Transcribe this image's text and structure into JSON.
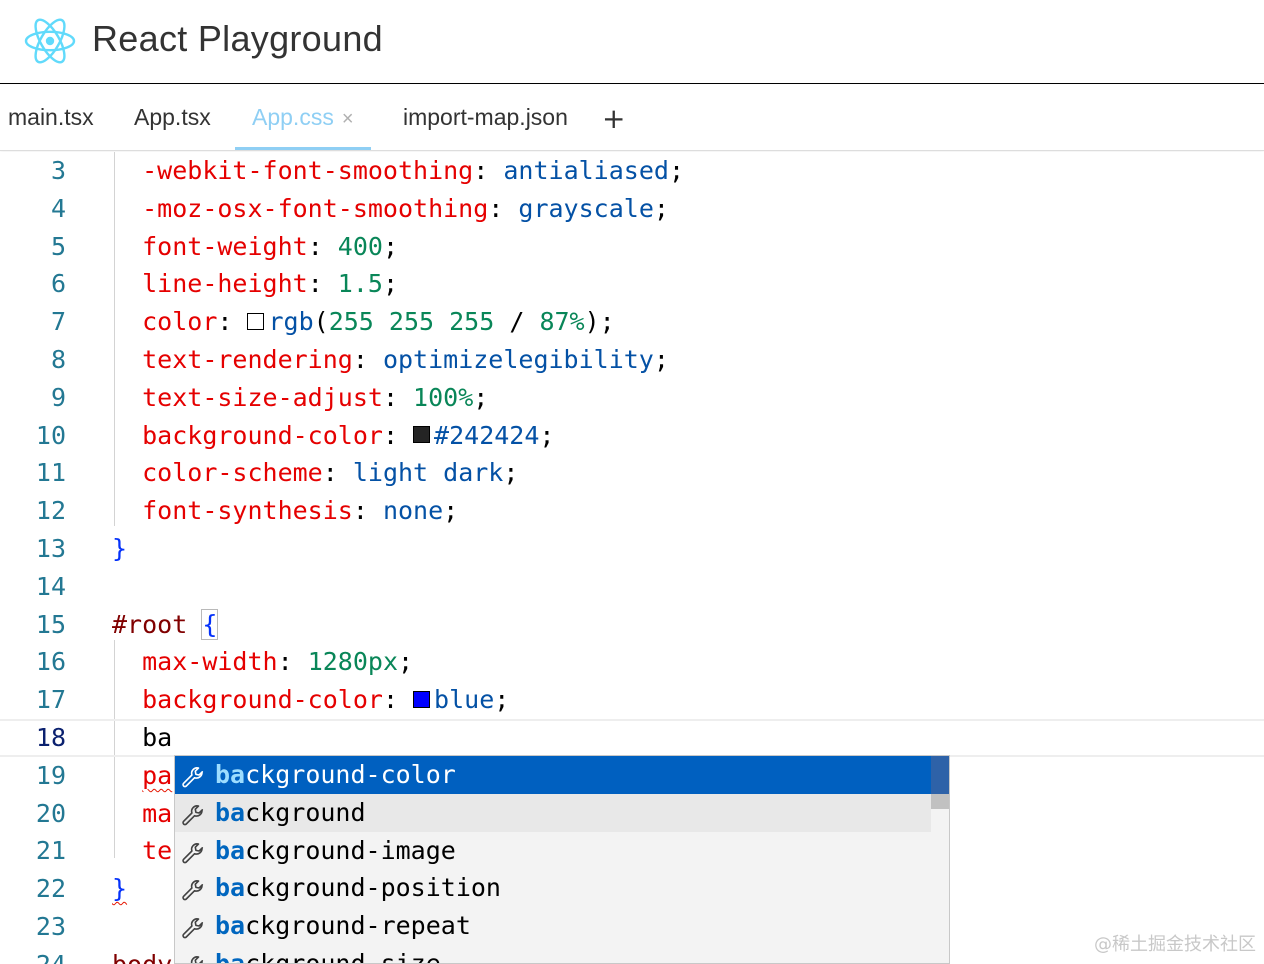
{
  "app": {
    "title": "React Playground",
    "logo_icon": "react-atom-icon",
    "accent_color": "#61dafb"
  },
  "tabs": [
    {
      "label": "main.tsx",
      "active": false
    },
    {
      "label": "App.tsx",
      "active": false
    },
    {
      "label": "App.css",
      "active": true,
      "close": "×"
    },
    {
      "label": "import-map.json",
      "active": false
    }
  ],
  "add_tab_label": "+",
  "editor": {
    "current_line": 18,
    "lines": [
      {
        "n": "3",
        "tokens": [
          [
            "prop",
            "-webkit-font-smoothing"
          ],
          [
            "pun",
            ": "
          ],
          [
            "val",
            "antialiased"
          ],
          [
            "pun",
            ";"
          ]
        ]
      },
      {
        "n": "4",
        "tokens": [
          [
            "prop",
            "-moz-osx-font-smoothing"
          ],
          [
            "pun",
            ": "
          ],
          [
            "val",
            "grayscale"
          ],
          [
            "pun",
            ";"
          ]
        ]
      },
      {
        "n": "5",
        "tokens": [
          [
            "prop",
            "font-weight"
          ],
          [
            "pun",
            ": "
          ],
          [
            "num",
            "400"
          ],
          [
            "pun",
            ";"
          ]
        ]
      },
      {
        "n": "6",
        "tokens": [
          [
            "prop",
            "line-height"
          ],
          [
            "pun",
            ": "
          ],
          [
            "num",
            "1.5"
          ],
          [
            "pun",
            ";"
          ]
        ]
      },
      {
        "n": "7",
        "tokens": [
          [
            "prop",
            "color"
          ],
          [
            "pun",
            ": "
          ],
          [
            "swatch",
            "#ffffff"
          ],
          [
            "val",
            "rgb"
          ],
          [
            "pun",
            "("
          ],
          [
            "num",
            "255 255 255"
          ],
          [
            "pun",
            " / "
          ],
          [
            "num",
            "87%"
          ],
          [
            "pun",
            ");"
          ]
        ]
      },
      {
        "n": "8",
        "tokens": [
          [
            "prop",
            "text-rendering"
          ],
          [
            "pun",
            ": "
          ],
          [
            "val",
            "optimizelegibility"
          ],
          [
            "pun",
            ";"
          ]
        ]
      },
      {
        "n": "9",
        "tokens": [
          [
            "prop",
            "text-size-adjust"
          ],
          [
            "pun",
            ": "
          ],
          [
            "num",
            "100%"
          ],
          [
            "pun",
            ";"
          ]
        ]
      },
      {
        "n": "10",
        "tokens": [
          [
            "prop",
            "background-color"
          ],
          [
            "pun",
            ": "
          ],
          [
            "swatch",
            "#242424"
          ],
          [
            "val",
            "#242424"
          ],
          [
            "pun",
            ";"
          ]
        ]
      },
      {
        "n": "11",
        "tokens": [
          [
            "prop",
            "color-scheme"
          ],
          [
            "pun",
            ": "
          ],
          [
            "val",
            "light dark"
          ],
          [
            "pun",
            ";"
          ]
        ]
      },
      {
        "n": "12",
        "tokens": [
          [
            "prop",
            "font-synthesis"
          ],
          [
            "pun",
            ": "
          ],
          [
            "val",
            "none"
          ],
          [
            "pun",
            ";"
          ]
        ]
      },
      {
        "n": "13",
        "tokens": [
          [
            "brace",
            "}"
          ]
        ]
      },
      {
        "n": "14",
        "tokens": []
      },
      {
        "n": "15",
        "tokens": [
          [
            "sel",
            "#root "
          ],
          [
            "brace-box",
            "{"
          ]
        ]
      },
      {
        "n": "16",
        "tokens": [
          [
            "prop",
            "max-width"
          ],
          [
            "pun",
            ": "
          ],
          [
            "num",
            "1280px"
          ],
          [
            "pun",
            ";"
          ]
        ]
      },
      {
        "n": "17",
        "tokens": [
          [
            "prop",
            "background-color"
          ],
          [
            "pun",
            ": "
          ],
          [
            "swatch",
            "#0000ff"
          ],
          [
            "val",
            "blue"
          ],
          [
            "pun",
            ";"
          ]
        ]
      },
      {
        "n": "18",
        "tokens": [
          [
            "pun",
            "ba"
          ]
        ]
      },
      {
        "n": "19",
        "tokens": [
          [
            "prop-squiggle",
            "pa"
          ]
        ]
      },
      {
        "n": "20",
        "tokens": [
          [
            "prop",
            "ma"
          ]
        ]
      },
      {
        "n": "21",
        "tokens": [
          [
            "prop",
            "te"
          ]
        ]
      },
      {
        "n": "22",
        "tokens": [
          [
            "brace-squiggle",
            "}"
          ]
        ]
      },
      {
        "n": "23",
        "tokens": []
      },
      {
        "n": "24",
        "tokens": [
          [
            "sel",
            "body"
          ]
        ]
      }
    ]
  },
  "suggest": {
    "typed": "ba",
    "item_icon": "wrench-icon",
    "items": [
      {
        "label": "background-color",
        "selected": true
      },
      {
        "label": "background",
        "hover": true
      },
      {
        "label": "background-image"
      },
      {
        "label": "background-position"
      },
      {
        "label": "background-repeat"
      },
      {
        "label": "background-size"
      }
    ]
  },
  "watermark": "@稀土掘金技术社区"
}
